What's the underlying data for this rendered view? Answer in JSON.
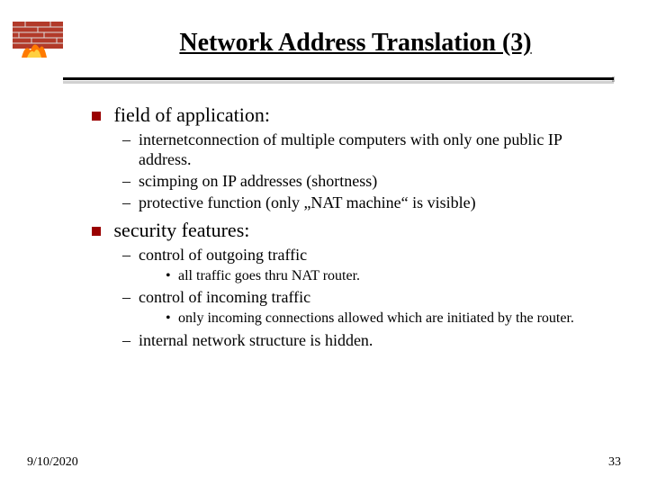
{
  "title": "Network Address Translation (3)",
  "bullets": {
    "b1": {
      "label": "field of application:",
      "items": [
        "internetconnection of multiple computers with only one public IP address.",
        "scimping on IP addresses (shortness)",
        "protective function (only „NAT machine“ is visible)"
      ]
    },
    "b2": {
      "label": "security features:",
      "s1": {
        "label": "control of outgoing traffic",
        "items": [
          "all traffic goes thru NAT router."
        ]
      },
      "s2": {
        "label": "control of incoming traffic",
        "items": [
          "only incoming connections allowed which are initiated by the router."
        ]
      },
      "s3": {
        "label": "internal network structure is hidden."
      }
    }
  },
  "footer": {
    "date": "9/10/2020",
    "page": "33"
  },
  "icon": {
    "name": "firewall-icon"
  }
}
